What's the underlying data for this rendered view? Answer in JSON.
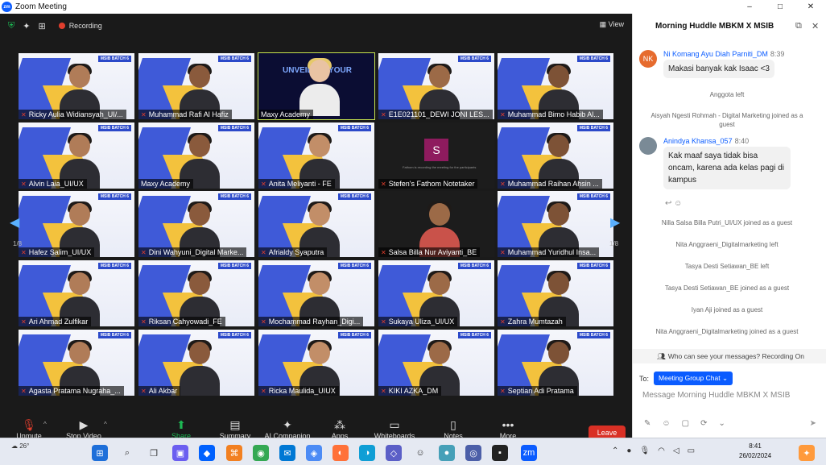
{
  "window": {
    "logo_text": "zm",
    "title": "Zoom Meeting",
    "controls": [
      "–",
      "□",
      "✕"
    ]
  },
  "topbar": {
    "recording": "Recording",
    "view": "View"
  },
  "grid": {
    "page_left": "1/8",
    "page_right": "1/8",
    "tiles": [
      {
        "name": "Ricky Aulia Widiansyah_UI/...",
        "type": "cam",
        "muted": true
      },
      {
        "name": "Muhammad Rafi Al Hafiz",
        "type": "cam",
        "muted": true
      },
      {
        "name": "Maxy Academy",
        "type": "slide",
        "muted": false,
        "active": true,
        "slide_text": "UNVEILING YOUR"
      },
      {
        "name": "E1E021101_DEWI JONI LES...",
        "type": "cam",
        "muted": true
      },
      {
        "name": "Muhammad Bimo Habib Al...",
        "type": "cam",
        "muted": true
      },
      {
        "name": "Alvin Laia_UI/UX",
        "type": "cam",
        "muted": true
      },
      {
        "name": "Maxy Academy",
        "type": "cam",
        "muted": false
      },
      {
        "name": "Anita Meliyanti - FE",
        "type": "cam",
        "muted": true
      },
      {
        "name": "Stefen's Fathom Notetaker",
        "type": "notetaker",
        "muted": true,
        "initial": "S",
        "note": "Fathom is recording the meeting for the participants"
      },
      {
        "name": "Muhammad Raihan Ahsin ...",
        "type": "cam",
        "muted": true
      },
      {
        "name": "Hafez Salim_UI/UX",
        "type": "cam",
        "muted": true
      },
      {
        "name": "Dini Wahyuni_Digital Marke...",
        "type": "cam",
        "muted": true
      },
      {
        "name": "Afrialdy Syaputra",
        "type": "cam",
        "muted": true
      },
      {
        "name": "Salsa Billa Nur Aviyanti_BE",
        "type": "darkcam",
        "muted": true
      },
      {
        "name": "Muhammad Yuridhul Insa...",
        "type": "cam",
        "muted": true
      },
      {
        "name": "Ari Ahmad Zulfikar",
        "type": "cam",
        "muted": true
      },
      {
        "name": "Riksan Cahyowadi_FE",
        "type": "cam",
        "muted": true
      },
      {
        "name": "Mochammad Rayhan_Digi...",
        "type": "cam",
        "muted": true
      },
      {
        "name": "Sukaya Uliza_UI/UX",
        "type": "cam",
        "muted": true
      },
      {
        "name": "Zahra Mumtazah",
        "type": "cam",
        "muted": true
      },
      {
        "name": "Agasta Pratama Nugraha_...",
        "type": "cam",
        "muted": true
      },
      {
        "name": "Ali Akbar",
        "type": "cam",
        "muted": true
      },
      {
        "name": "Ricka Maulida_UIUX",
        "type": "cam",
        "muted": true
      },
      {
        "name": "KIKI AZKA_DM",
        "type": "cam",
        "muted": true
      },
      {
        "name": "Septian Adi Pratama",
        "type": "cam",
        "muted": true
      }
    ],
    "banner_label": "MSIB BATCH 6"
  },
  "controls": [
    {
      "label": "Unmute",
      "icon": "mic-off-icon"
    },
    {
      "label": "Stop Video",
      "icon": "video-icon"
    },
    {
      "label": "Share Screen",
      "icon": "share-screen-icon"
    },
    {
      "label": "Summary",
      "icon": "summary-icon"
    },
    {
      "label": "AI Companion",
      "icon": "ai-companion-icon"
    },
    {
      "label": "Apps",
      "icon": "apps-icon"
    },
    {
      "label": "Whiteboards",
      "icon": "whiteboard-icon"
    },
    {
      "label": "Notes",
      "icon": "notes-icon"
    },
    {
      "label": "More",
      "icon": "more-icon"
    }
  ],
  "leave": "Leave",
  "chat": {
    "title": "Morning Huddle MBKM X MSIB",
    "messages": [
      {
        "sender": "Ni Komang Ayu Diah Parniti_DM",
        "time": "8:39",
        "avatar": "NK",
        "text": "Makasi banyak kak Isaac <3"
      },
      {
        "sender": "Anindya Khansa_057",
        "time": "8:40",
        "avatar": "",
        "text": "Kak maaf saya tidak bisa oncam, karena ada kelas pagi di kampus"
      }
    ],
    "system": [
      "Anggota left",
      "Aisyah Ngesti Rohmah - Digital Marketing joined as a guest",
      "Nilla Salsa Billa Putri_UI/UX joined as a guest",
      "Nita Anggraeni_Digitalmarketing left",
      "Tasya Desti Setiawan_BE left",
      "Tasya Desti Setiawan_BE joined as a guest",
      "Iyan Aji joined as a guest",
      "Nita Anggraeni_Digitalmarketing joined as a guest"
    ],
    "privacy": "Who can see your messages? Recording On",
    "to_label": "To:",
    "to_value": "Meeting Group Chat",
    "input_placeholder": "Message Morning Huddle MBKM X MSIB"
  },
  "taskbar": {
    "weather": "26°",
    "time": "8:41",
    "date": "26/02/2024"
  },
  "colors": {
    "zoom_blue": "#0b5cff",
    "leave_red": "#d93025",
    "share_green": "#1db954",
    "active_border": "#c7e34e"
  }
}
